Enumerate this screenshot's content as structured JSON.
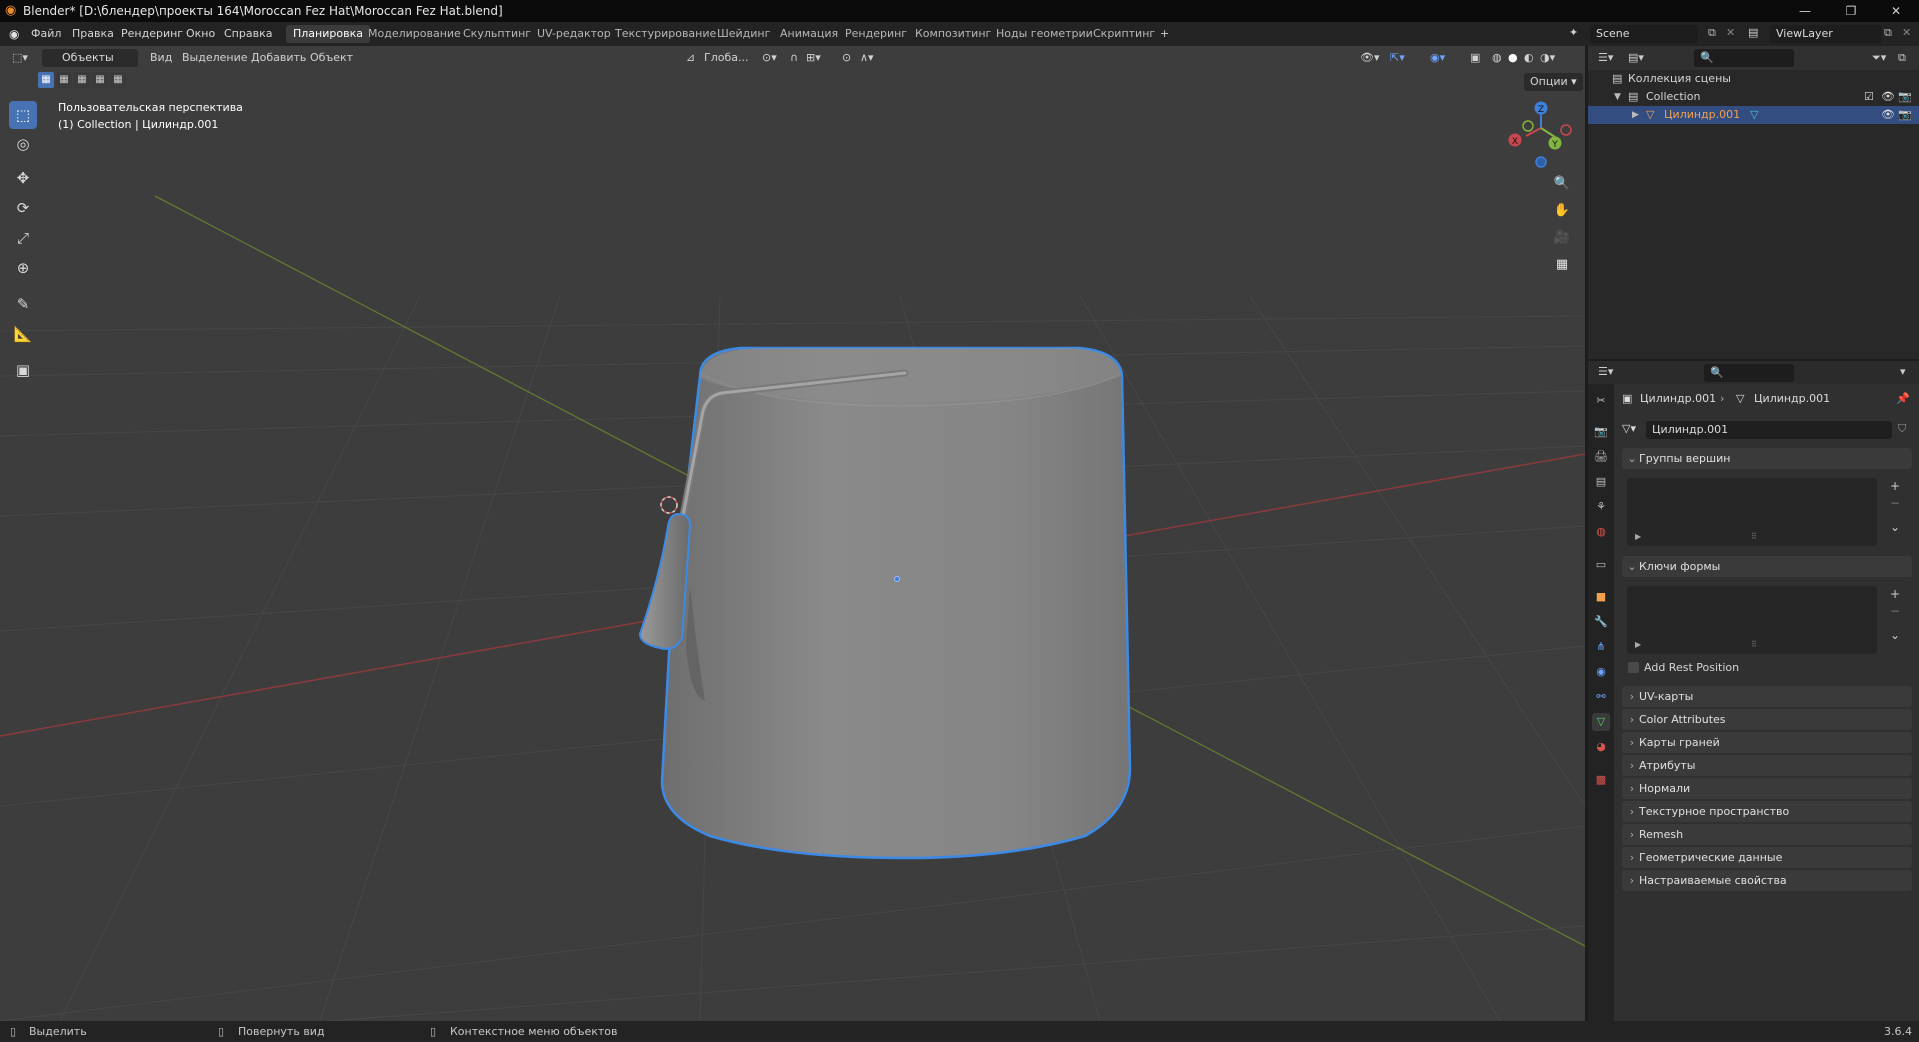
{
  "titlebar": {
    "title": "Blender* [D:\\блендер\\проекты 164\\Moroccan Fez Hat\\Moroccan Fez Hat.blend]",
    "minimize": "—",
    "maximize": "❐",
    "close": "✕"
  },
  "menu": {
    "items": [
      "Файл",
      "Правка",
      "Рендеринг",
      "Окно",
      "Справка"
    ]
  },
  "workspaces": {
    "tabs": [
      "Планировка",
      "Моделирование",
      "Скульптинг",
      "UV-редактор",
      "Текстурирование",
      "Шейдинг",
      "Анимация",
      "Рендеринг",
      "Композитинг",
      "Ноды геометрии",
      "Скриптинг"
    ],
    "active": "Планировка",
    "add": "+"
  },
  "scene": {
    "name": "Scene",
    "view_layer": "ViewLayer"
  },
  "viewport_header": {
    "mode": "Объекты",
    "menus": [
      "Вид",
      "Выделение",
      "Добавить",
      "Объект"
    ],
    "orientation": "Глоба...",
    "options": "Опции"
  },
  "viewport": {
    "view_name": "Пользовательская перспектива",
    "collection_info": "(1) Collection | Цилиндр.001",
    "gizmo_labels": {
      "x": "X",
      "y": "Y",
      "z": "Z"
    }
  },
  "outliner": {
    "root": "Коллекция сцены",
    "collection": "Collection",
    "object": "Цилиндр.001"
  },
  "properties": {
    "breadcrumb_object": "Цилиндр.001",
    "breadcrumb_data": "Цилиндр.001",
    "mesh_name": "Цилиндр.001",
    "panels_open": [
      {
        "label": "Группы вершин"
      },
      {
        "label": "Ключи формы"
      }
    ],
    "add_rest_position": "Add Rest Position",
    "panels_closed": [
      "UV-карты",
      "Color Attributes",
      "Карты граней",
      "Атрибуты",
      "Нормали",
      "Текстурное пространство",
      "Remesh",
      "Геометрические данные",
      "Настраиваемые свойства"
    ]
  },
  "status": {
    "select": "Выделить",
    "rotate": "Повернуть вид",
    "context": "Контекстное меню объектов",
    "version": "3.6.4"
  },
  "colors": {
    "accent": "#4772b3",
    "selection_outline": "#3d8ae6",
    "x_axis": "#c9474f",
    "y_axis": "#82b53f",
    "z_axis": "#3d7fd9",
    "active_object_text": "#f2a14d"
  }
}
